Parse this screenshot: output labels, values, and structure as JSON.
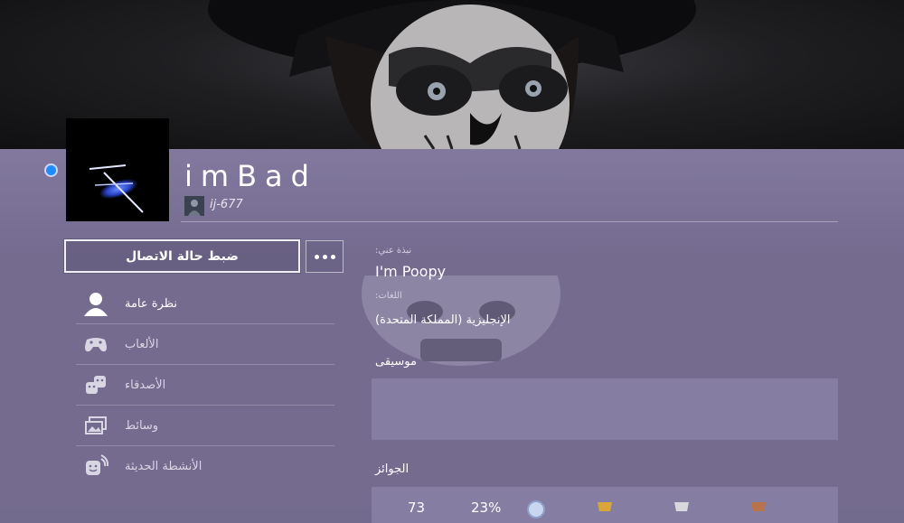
{
  "profile": {
    "username": "imBad",
    "online_id": "ij-677",
    "status_button": "ضبط حالة الاتصال",
    "online": true
  },
  "menu": [
    {
      "label": "نظرة عامة",
      "icon": "person-icon",
      "active": true
    },
    {
      "label": "الألعاب",
      "icon": "controller-icon",
      "active": false
    },
    {
      "label": "الأصدقاء",
      "icon": "friends-icon",
      "active": false
    },
    {
      "label": "وسائط",
      "icon": "media-icon",
      "active": false
    },
    {
      "label": "الأنشطة الحديثة",
      "icon": "activity-icon",
      "active": false
    }
  ],
  "about": {
    "bio_label": "نبذة عني:",
    "bio": "I'm Poopy",
    "languages_label": "اللغات:",
    "languages": "الإنجليزية (المملكة المتحدة)"
  },
  "sections": {
    "music": "موسيقى",
    "trophies": "الجوائز"
  },
  "trophies": {
    "level": "73",
    "progress": "23%",
    "icons": [
      "platinum-trophy-icon",
      "gold-trophy-icon",
      "silver-trophy-icon",
      "bronze-trophy-icon"
    ]
  },
  "colors": {
    "background": "#736b8e",
    "online_dot": "#1e8cff",
    "avatar_glow": "#3a63ff"
  }
}
